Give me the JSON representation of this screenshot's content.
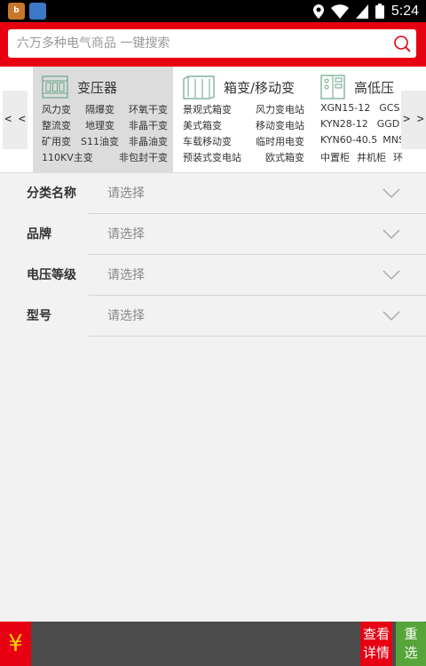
{
  "search": {
    "placeholder": "六万多种电气商品 一键搜索"
  },
  "status": {
    "time": "5:24"
  },
  "nav": {
    "left_label": "< <",
    "right_label": "> >"
  },
  "categories": [
    {
      "title": "变压器",
      "rows": [
        [
          "风力变",
          "隔爆变",
          "环氧干变"
        ],
        [
          "整流变",
          "地理变",
          "非晶干变"
        ],
        [
          "矿用变",
          "S11油变",
          "非晶油变"
        ],
        [
          "110KV主变",
          "非包封干变"
        ]
      ]
    },
    {
      "title": "箱变/移动变",
      "rows": [
        [
          "景观式箱变",
          "风力变电站"
        ],
        [
          "美式箱变",
          "移动变电站"
        ],
        [
          "车载移动变",
          "临时用电变"
        ],
        [
          "预装式变电站",
          "欧式箱变"
        ]
      ]
    },
    {
      "title": "高低压",
      "rows": [
        [
          "XGN15-12",
          "GCS"
        ],
        [
          "KYN28-12",
          "GGD"
        ],
        [
          "KYN60-40.5",
          "MNS"
        ],
        [
          "中置柜",
          "井机柜",
          "环"
        ]
      ]
    }
  ],
  "filters": [
    {
      "label": "分类名称",
      "value": "请选择"
    },
    {
      "label": "品牌",
      "value": "请选择"
    },
    {
      "label": "电压等级",
      "value": "请选择"
    },
    {
      "label": "型号",
      "value": "请选择"
    }
  ],
  "bottom": {
    "currency_symbol": "¥",
    "detail_line1": "查看",
    "detail_line2": "详情",
    "reset_line1": "重",
    "reset_line2": "选"
  },
  "colors": {
    "brand_red": "#e60012",
    "reset_green": "#57a53a",
    "bar_dark": "#4c4c4c",
    "yuan_yellow": "#ffd200"
  }
}
